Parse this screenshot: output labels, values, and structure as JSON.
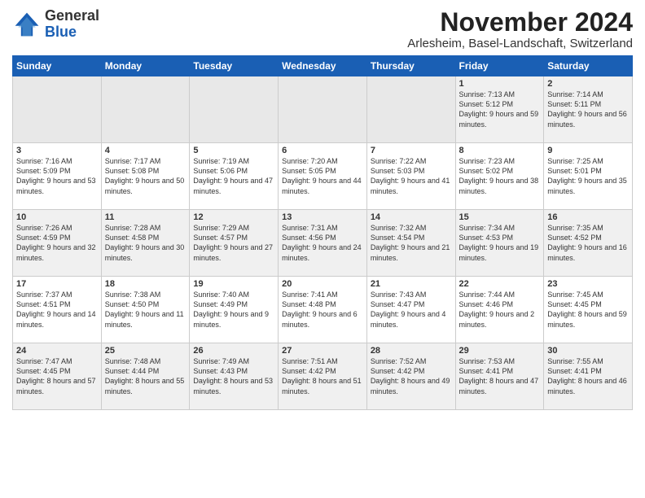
{
  "app": {
    "logo_general": "General",
    "logo_blue": "Blue",
    "title": "November 2024",
    "subtitle": "Arlesheim, Basel-Landschaft, Switzerland"
  },
  "calendar": {
    "headers": [
      "Sunday",
      "Monday",
      "Tuesday",
      "Wednesday",
      "Thursday",
      "Friday",
      "Saturday"
    ],
    "weeks": [
      [
        {
          "day": "",
          "info": ""
        },
        {
          "day": "",
          "info": ""
        },
        {
          "day": "",
          "info": ""
        },
        {
          "day": "",
          "info": ""
        },
        {
          "day": "",
          "info": ""
        },
        {
          "day": "1",
          "info": "Sunrise: 7:13 AM\nSunset: 5:12 PM\nDaylight: 9 hours and 59 minutes."
        },
        {
          "day": "2",
          "info": "Sunrise: 7:14 AM\nSunset: 5:11 PM\nDaylight: 9 hours and 56 minutes."
        }
      ],
      [
        {
          "day": "3",
          "info": "Sunrise: 7:16 AM\nSunset: 5:09 PM\nDaylight: 9 hours and 53 minutes."
        },
        {
          "day": "4",
          "info": "Sunrise: 7:17 AM\nSunset: 5:08 PM\nDaylight: 9 hours and 50 minutes."
        },
        {
          "day": "5",
          "info": "Sunrise: 7:19 AM\nSunset: 5:06 PM\nDaylight: 9 hours and 47 minutes."
        },
        {
          "day": "6",
          "info": "Sunrise: 7:20 AM\nSunset: 5:05 PM\nDaylight: 9 hours and 44 minutes."
        },
        {
          "day": "7",
          "info": "Sunrise: 7:22 AM\nSunset: 5:03 PM\nDaylight: 9 hours and 41 minutes."
        },
        {
          "day": "8",
          "info": "Sunrise: 7:23 AM\nSunset: 5:02 PM\nDaylight: 9 hours and 38 minutes."
        },
        {
          "day": "9",
          "info": "Sunrise: 7:25 AM\nSunset: 5:01 PM\nDaylight: 9 hours and 35 minutes."
        }
      ],
      [
        {
          "day": "10",
          "info": "Sunrise: 7:26 AM\nSunset: 4:59 PM\nDaylight: 9 hours and 32 minutes."
        },
        {
          "day": "11",
          "info": "Sunrise: 7:28 AM\nSunset: 4:58 PM\nDaylight: 9 hours and 30 minutes."
        },
        {
          "day": "12",
          "info": "Sunrise: 7:29 AM\nSunset: 4:57 PM\nDaylight: 9 hours and 27 minutes."
        },
        {
          "day": "13",
          "info": "Sunrise: 7:31 AM\nSunset: 4:56 PM\nDaylight: 9 hours and 24 minutes."
        },
        {
          "day": "14",
          "info": "Sunrise: 7:32 AM\nSunset: 4:54 PM\nDaylight: 9 hours and 21 minutes."
        },
        {
          "day": "15",
          "info": "Sunrise: 7:34 AM\nSunset: 4:53 PM\nDaylight: 9 hours and 19 minutes."
        },
        {
          "day": "16",
          "info": "Sunrise: 7:35 AM\nSunset: 4:52 PM\nDaylight: 9 hours and 16 minutes."
        }
      ],
      [
        {
          "day": "17",
          "info": "Sunrise: 7:37 AM\nSunset: 4:51 PM\nDaylight: 9 hours and 14 minutes."
        },
        {
          "day": "18",
          "info": "Sunrise: 7:38 AM\nSunset: 4:50 PM\nDaylight: 9 hours and 11 minutes."
        },
        {
          "day": "19",
          "info": "Sunrise: 7:40 AM\nSunset: 4:49 PM\nDaylight: 9 hours and 9 minutes."
        },
        {
          "day": "20",
          "info": "Sunrise: 7:41 AM\nSunset: 4:48 PM\nDaylight: 9 hours and 6 minutes."
        },
        {
          "day": "21",
          "info": "Sunrise: 7:43 AM\nSunset: 4:47 PM\nDaylight: 9 hours and 4 minutes."
        },
        {
          "day": "22",
          "info": "Sunrise: 7:44 AM\nSunset: 4:46 PM\nDaylight: 9 hours and 2 minutes."
        },
        {
          "day": "23",
          "info": "Sunrise: 7:45 AM\nSunset: 4:45 PM\nDaylight: 8 hours and 59 minutes."
        }
      ],
      [
        {
          "day": "24",
          "info": "Sunrise: 7:47 AM\nSunset: 4:45 PM\nDaylight: 8 hours and 57 minutes."
        },
        {
          "day": "25",
          "info": "Sunrise: 7:48 AM\nSunset: 4:44 PM\nDaylight: 8 hours and 55 minutes."
        },
        {
          "day": "26",
          "info": "Sunrise: 7:49 AM\nSunset: 4:43 PM\nDaylight: 8 hours and 53 minutes."
        },
        {
          "day": "27",
          "info": "Sunrise: 7:51 AM\nSunset: 4:42 PM\nDaylight: 8 hours and 51 minutes."
        },
        {
          "day": "28",
          "info": "Sunrise: 7:52 AM\nSunset: 4:42 PM\nDaylight: 8 hours and 49 minutes."
        },
        {
          "day": "29",
          "info": "Sunrise: 7:53 AM\nSunset: 4:41 PM\nDaylight: 8 hours and 47 minutes."
        },
        {
          "day": "30",
          "info": "Sunrise: 7:55 AM\nSunset: 4:41 PM\nDaylight: 8 hours and 46 minutes."
        }
      ]
    ]
  }
}
